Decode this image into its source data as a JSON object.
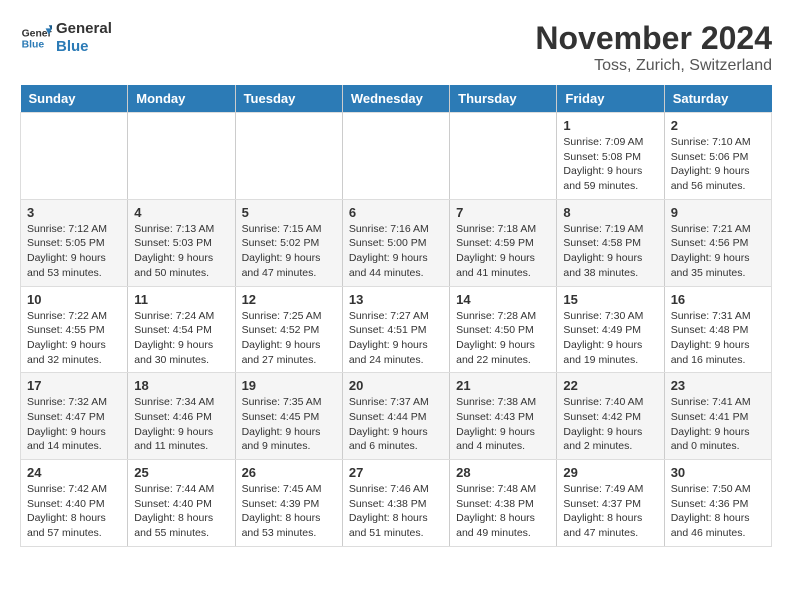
{
  "logo": {
    "line1": "General",
    "line2": "Blue"
  },
  "title": "November 2024",
  "location": "Toss, Zurich, Switzerland",
  "days_of_week": [
    "Sunday",
    "Monday",
    "Tuesday",
    "Wednesday",
    "Thursday",
    "Friday",
    "Saturday"
  ],
  "weeks": [
    [
      {
        "day": "",
        "info": ""
      },
      {
        "day": "",
        "info": ""
      },
      {
        "day": "",
        "info": ""
      },
      {
        "day": "",
        "info": ""
      },
      {
        "day": "",
        "info": ""
      },
      {
        "day": "1",
        "info": "Sunrise: 7:09 AM\nSunset: 5:08 PM\nDaylight: 9 hours and 59 minutes."
      },
      {
        "day": "2",
        "info": "Sunrise: 7:10 AM\nSunset: 5:06 PM\nDaylight: 9 hours and 56 minutes."
      }
    ],
    [
      {
        "day": "3",
        "info": "Sunrise: 7:12 AM\nSunset: 5:05 PM\nDaylight: 9 hours and 53 minutes."
      },
      {
        "day": "4",
        "info": "Sunrise: 7:13 AM\nSunset: 5:03 PM\nDaylight: 9 hours and 50 minutes."
      },
      {
        "day": "5",
        "info": "Sunrise: 7:15 AM\nSunset: 5:02 PM\nDaylight: 9 hours and 47 minutes."
      },
      {
        "day": "6",
        "info": "Sunrise: 7:16 AM\nSunset: 5:00 PM\nDaylight: 9 hours and 44 minutes."
      },
      {
        "day": "7",
        "info": "Sunrise: 7:18 AM\nSunset: 4:59 PM\nDaylight: 9 hours and 41 minutes."
      },
      {
        "day": "8",
        "info": "Sunrise: 7:19 AM\nSunset: 4:58 PM\nDaylight: 9 hours and 38 minutes."
      },
      {
        "day": "9",
        "info": "Sunrise: 7:21 AM\nSunset: 4:56 PM\nDaylight: 9 hours and 35 minutes."
      }
    ],
    [
      {
        "day": "10",
        "info": "Sunrise: 7:22 AM\nSunset: 4:55 PM\nDaylight: 9 hours and 32 minutes."
      },
      {
        "day": "11",
        "info": "Sunrise: 7:24 AM\nSunset: 4:54 PM\nDaylight: 9 hours and 30 minutes."
      },
      {
        "day": "12",
        "info": "Sunrise: 7:25 AM\nSunset: 4:52 PM\nDaylight: 9 hours and 27 minutes."
      },
      {
        "day": "13",
        "info": "Sunrise: 7:27 AM\nSunset: 4:51 PM\nDaylight: 9 hours and 24 minutes."
      },
      {
        "day": "14",
        "info": "Sunrise: 7:28 AM\nSunset: 4:50 PM\nDaylight: 9 hours and 22 minutes."
      },
      {
        "day": "15",
        "info": "Sunrise: 7:30 AM\nSunset: 4:49 PM\nDaylight: 9 hours and 19 minutes."
      },
      {
        "day": "16",
        "info": "Sunrise: 7:31 AM\nSunset: 4:48 PM\nDaylight: 9 hours and 16 minutes."
      }
    ],
    [
      {
        "day": "17",
        "info": "Sunrise: 7:32 AM\nSunset: 4:47 PM\nDaylight: 9 hours and 14 minutes."
      },
      {
        "day": "18",
        "info": "Sunrise: 7:34 AM\nSunset: 4:46 PM\nDaylight: 9 hours and 11 minutes."
      },
      {
        "day": "19",
        "info": "Sunrise: 7:35 AM\nSunset: 4:45 PM\nDaylight: 9 hours and 9 minutes."
      },
      {
        "day": "20",
        "info": "Sunrise: 7:37 AM\nSunset: 4:44 PM\nDaylight: 9 hours and 6 minutes."
      },
      {
        "day": "21",
        "info": "Sunrise: 7:38 AM\nSunset: 4:43 PM\nDaylight: 9 hours and 4 minutes."
      },
      {
        "day": "22",
        "info": "Sunrise: 7:40 AM\nSunset: 4:42 PM\nDaylight: 9 hours and 2 minutes."
      },
      {
        "day": "23",
        "info": "Sunrise: 7:41 AM\nSunset: 4:41 PM\nDaylight: 9 hours and 0 minutes."
      }
    ],
    [
      {
        "day": "24",
        "info": "Sunrise: 7:42 AM\nSunset: 4:40 PM\nDaylight: 8 hours and 57 minutes."
      },
      {
        "day": "25",
        "info": "Sunrise: 7:44 AM\nSunset: 4:40 PM\nDaylight: 8 hours and 55 minutes."
      },
      {
        "day": "26",
        "info": "Sunrise: 7:45 AM\nSunset: 4:39 PM\nDaylight: 8 hours and 53 minutes."
      },
      {
        "day": "27",
        "info": "Sunrise: 7:46 AM\nSunset: 4:38 PM\nDaylight: 8 hours and 51 minutes."
      },
      {
        "day": "28",
        "info": "Sunrise: 7:48 AM\nSunset: 4:38 PM\nDaylight: 8 hours and 49 minutes."
      },
      {
        "day": "29",
        "info": "Sunrise: 7:49 AM\nSunset: 4:37 PM\nDaylight: 8 hours and 47 minutes."
      },
      {
        "day": "30",
        "info": "Sunrise: 7:50 AM\nSunset: 4:36 PM\nDaylight: 8 hours and 46 minutes."
      }
    ]
  ]
}
